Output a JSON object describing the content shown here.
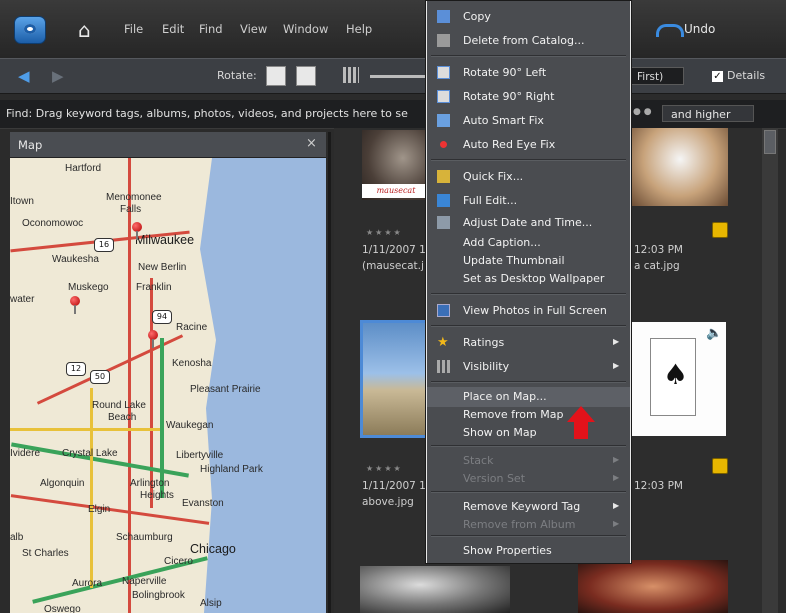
{
  "topbar": {
    "menu": [
      "File",
      "Edit",
      "Find",
      "View",
      "Window",
      "Help"
    ],
    "undo_label": "Undo"
  },
  "toolbar": {
    "rotate_label": "Rotate:",
    "sort_value": "First)",
    "details_label": "Details",
    "details_checked": true
  },
  "findbar": {
    "text": "Find: Drag keyword tags, albums, photos, videos, and projects here to se",
    "rating_filter": "and higher"
  },
  "map": {
    "title": "Map",
    "close_glyph": "×",
    "cities": [
      "Hartford",
      "Menomonee",
      "Falls",
      "Itown",
      "Oconomowoc",
      "Milwaukee",
      "Waukesha",
      "New Berlin",
      "Muskego",
      "Franklin",
      "water",
      "Racine",
      "Kenosha",
      "Pleasant Prairie",
      "Round Lake",
      "Beach",
      "Waukegan",
      "Ividere",
      "Crystal Lake",
      "Libertyville",
      "Highland Park",
      "Algonquin",
      "Arlington",
      "Heights",
      "Evanston",
      "Elgin",
      "alb",
      "Schaumburg",
      "St Charles",
      "Chicago",
      "Cicero",
      "Aurora",
      "Naperville",
      "Bolingbrook",
      "Alsip",
      "Oswego"
    ],
    "route_shields": [
      "16",
      "94",
      "12",
      "50"
    ]
  },
  "photos": [
    {
      "caption": "mausecat",
      "date": "1/11/2007 1",
      "name": "(mausecat.j"
    },
    {
      "date": "12:03 PM",
      "name": "a cat.jpg"
    },
    {
      "date": "1/11/2007 1",
      "name": "above.jpg"
    },
    {
      "date": "12:03 PM"
    }
  ],
  "context_menu": {
    "items": [
      {
        "label": "Copy",
        "icon": "copy-icon"
      },
      {
        "label": "Delete from Catalog...",
        "icon": "trash-icon"
      },
      {
        "label": "Rotate 90° Left",
        "icon": "rotate-left-icon"
      },
      {
        "label": "Rotate 90° Right",
        "icon": "rotate-right-icon"
      },
      {
        "label": "Auto Smart Fix",
        "icon": "smart-fix-icon"
      },
      {
        "label": "Auto Red Eye Fix",
        "icon": "red-eye-icon"
      },
      {
        "label": "Quick Fix...",
        "icon": "quick-fix-icon"
      },
      {
        "label": "Full Edit...",
        "icon": "full-edit-icon"
      },
      {
        "label": "Adjust Date and Time...",
        "icon": "calendar-icon"
      },
      {
        "label": "Add Caption..."
      },
      {
        "label": "Update Thumbnail"
      },
      {
        "label": "Set as Desktop Wallpaper"
      },
      {
        "label": "View Photos in Full Screen",
        "icon": "full-screen-icon"
      },
      {
        "label": "Ratings",
        "icon": "star-icon",
        "submenu": true
      },
      {
        "label": "Visibility",
        "icon": "visibility-icon",
        "submenu": true
      },
      {
        "label": "Place on Map...",
        "highlighted": true
      },
      {
        "label": "Remove from Map"
      },
      {
        "label": "Show on Map"
      },
      {
        "label": "Stack",
        "disabled": true,
        "submenu": true
      },
      {
        "label": "Version Set",
        "disabled": true,
        "submenu": true
      },
      {
        "label": "Remove Keyword Tag",
        "submenu": true
      },
      {
        "label": "Remove from Album",
        "disabled": true,
        "submenu": true
      },
      {
        "label": "Show Properties"
      }
    ]
  },
  "colors": {
    "accent": "#4d8ad6",
    "highlight_arrow": "#e3121a",
    "menu_bg": "#4a4c50"
  }
}
